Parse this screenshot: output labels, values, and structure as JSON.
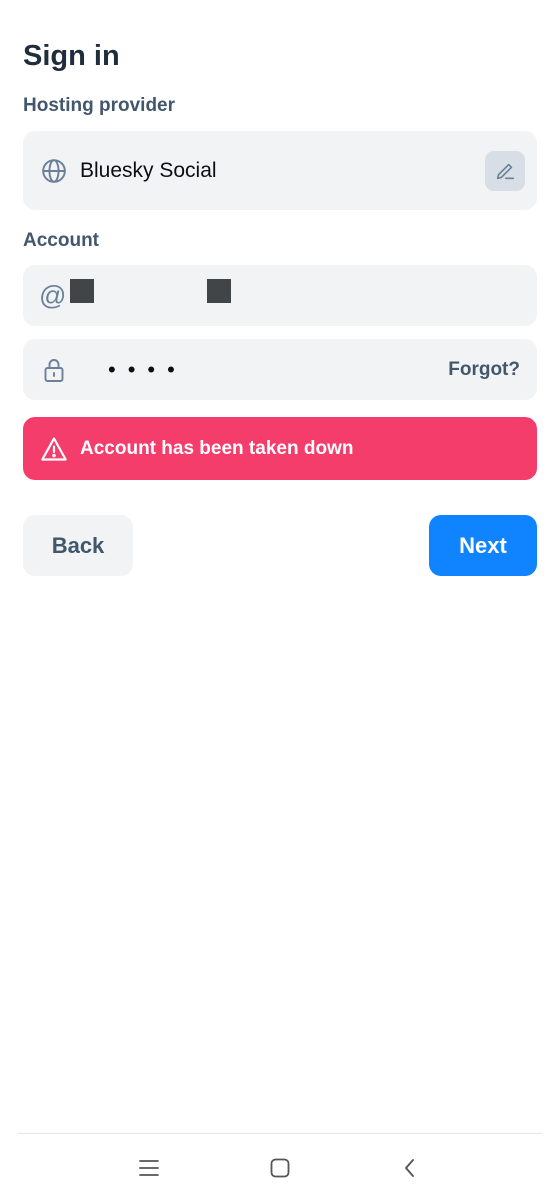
{
  "page": {
    "title": "Sign in"
  },
  "hosting": {
    "label": "Hosting provider",
    "provider": "Bluesky Social",
    "icon": "globe-icon",
    "edit_icon": "pencil-icon"
  },
  "account": {
    "label": "Account",
    "at_symbol": "@",
    "username_value": "",
    "password_mask": "••••",
    "forgot_label": "Forgot?",
    "lock_icon": "lock-icon"
  },
  "error": {
    "message": "Account has been taken down",
    "icon": "warning-icon",
    "color": "#f43d6a"
  },
  "actions": {
    "back_label": "Back",
    "next_label": "Next",
    "accent": "#1083fe"
  },
  "system_nav": {
    "menu_icon": "menu-icon",
    "home_icon": "square-home-icon",
    "back_icon": "chevron-left-icon"
  }
}
